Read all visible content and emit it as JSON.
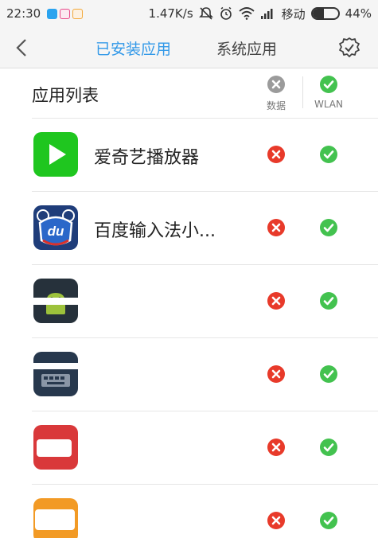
{
  "status_bar": {
    "time": "22:30",
    "speed": "1.47K/s",
    "carrier": "移动",
    "battery_text": "44%",
    "battery_level": 0.44,
    "notification_colors": [
      "#2aa3ef",
      "#e84b8a",
      "#f2a93b"
    ]
  },
  "header": {
    "tab_installed": "已安装应用",
    "tab_system": "系统应用",
    "active_tab": "已安装应用",
    "accent_color": "#3399e8"
  },
  "list_header": {
    "title": "应用列表",
    "col_data": "数据",
    "col_wlan": "WLAN"
  },
  "apps": [
    {
      "name": "爱奇艺播放器",
      "data_allowed": false,
      "wlan_allowed": true,
      "icon": "iqiyi-icon"
    },
    {
      "name": "百度输入法小...",
      "data_allowed": false,
      "wlan_allowed": true,
      "icon": "baidu-ime-icon"
    },
    {
      "name": "",
      "data_allowed": false,
      "wlan_allowed": true,
      "icon": "android-icon"
    },
    {
      "name": "",
      "data_allowed": false,
      "wlan_allowed": true,
      "icon": "keyboard-icon"
    },
    {
      "name": "",
      "data_allowed": false,
      "wlan_allowed": true,
      "icon": "red-app-icon"
    },
    {
      "name": "",
      "data_allowed": false,
      "wlan_allowed": true,
      "icon": "orange-app-icon"
    }
  ],
  "colors": {
    "deny": "#e83a2a",
    "allow": "#43c24f",
    "header_deny": "#9b9b9b"
  }
}
